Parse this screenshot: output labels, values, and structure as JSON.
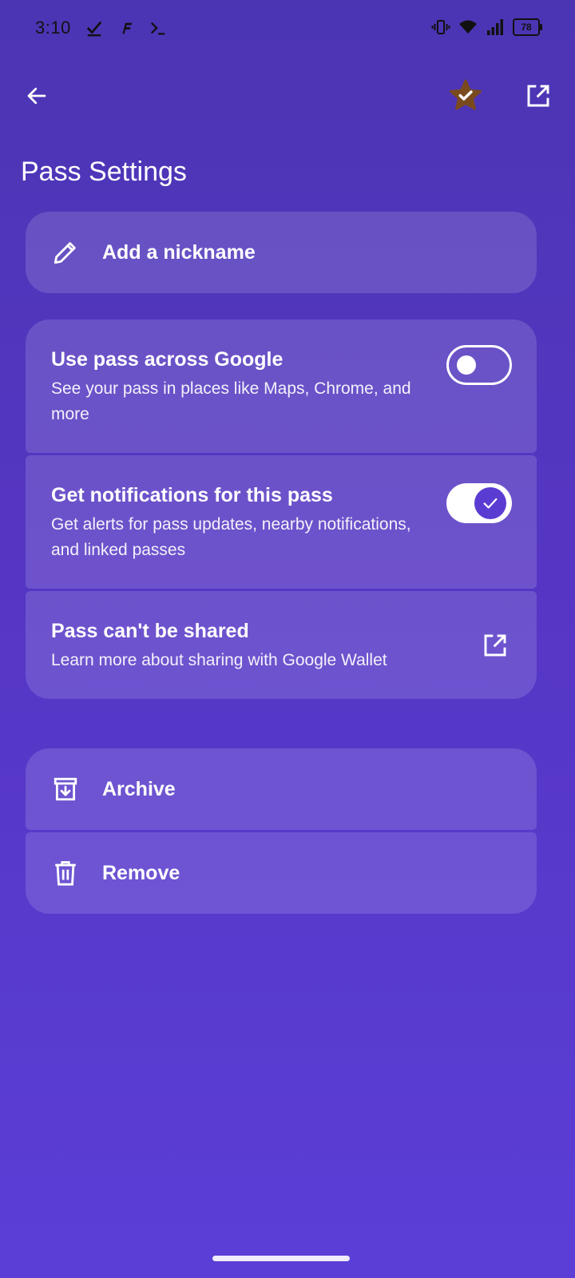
{
  "status_bar": {
    "time": "3:10",
    "battery_level": "78",
    "icons": [
      "check-icon",
      "app-f-icon",
      "terminal-icon",
      "vibrate-icon",
      "wifi-icon",
      "signal-icon",
      "battery-icon"
    ]
  },
  "app_bar": {
    "icons": [
      "back-arrow-icon",
      "star-check-icon",
      "open-external-icon"
    ]
  },
  "page": {
    "title": "Pass Settings"
  },
  "nickname": {
    "label": "Add a nickname",
    "icon": "pencil-icon"
  },
  "settings": {
    "use_across_google": {
      "title": "Use pass across Google",
      "description": "See your pass in places like Maps, Chrome, and more",
      "enabled": false
    },
    "notifications": {
      "title": "Get notifications for this pass",
      "description": "Get alerts for pass updates, nearby notifications, and linked passes",
      "enabled": true
    },
    "sharing": {
      "title": "Pass can't be shared",
      "description": "Learn more about sharing with Google Wallet",
      "icon": "open-external-icon"
    }
  },
  "actions": {
    "archive": {
      "label": "Archive",
      "icon": "archive-icon"
    },
    "remove": {
      "label": "Remove",
      "icon": "trash-icon"
    }
  },
  "colors": {
    "background_top": "#4c35b3",
    "background_bottom": "#5b3ed6",
    "toggle_knob_on": "#5b3cd2",
    "star_badge": "#7a4a1f"
  }
}
